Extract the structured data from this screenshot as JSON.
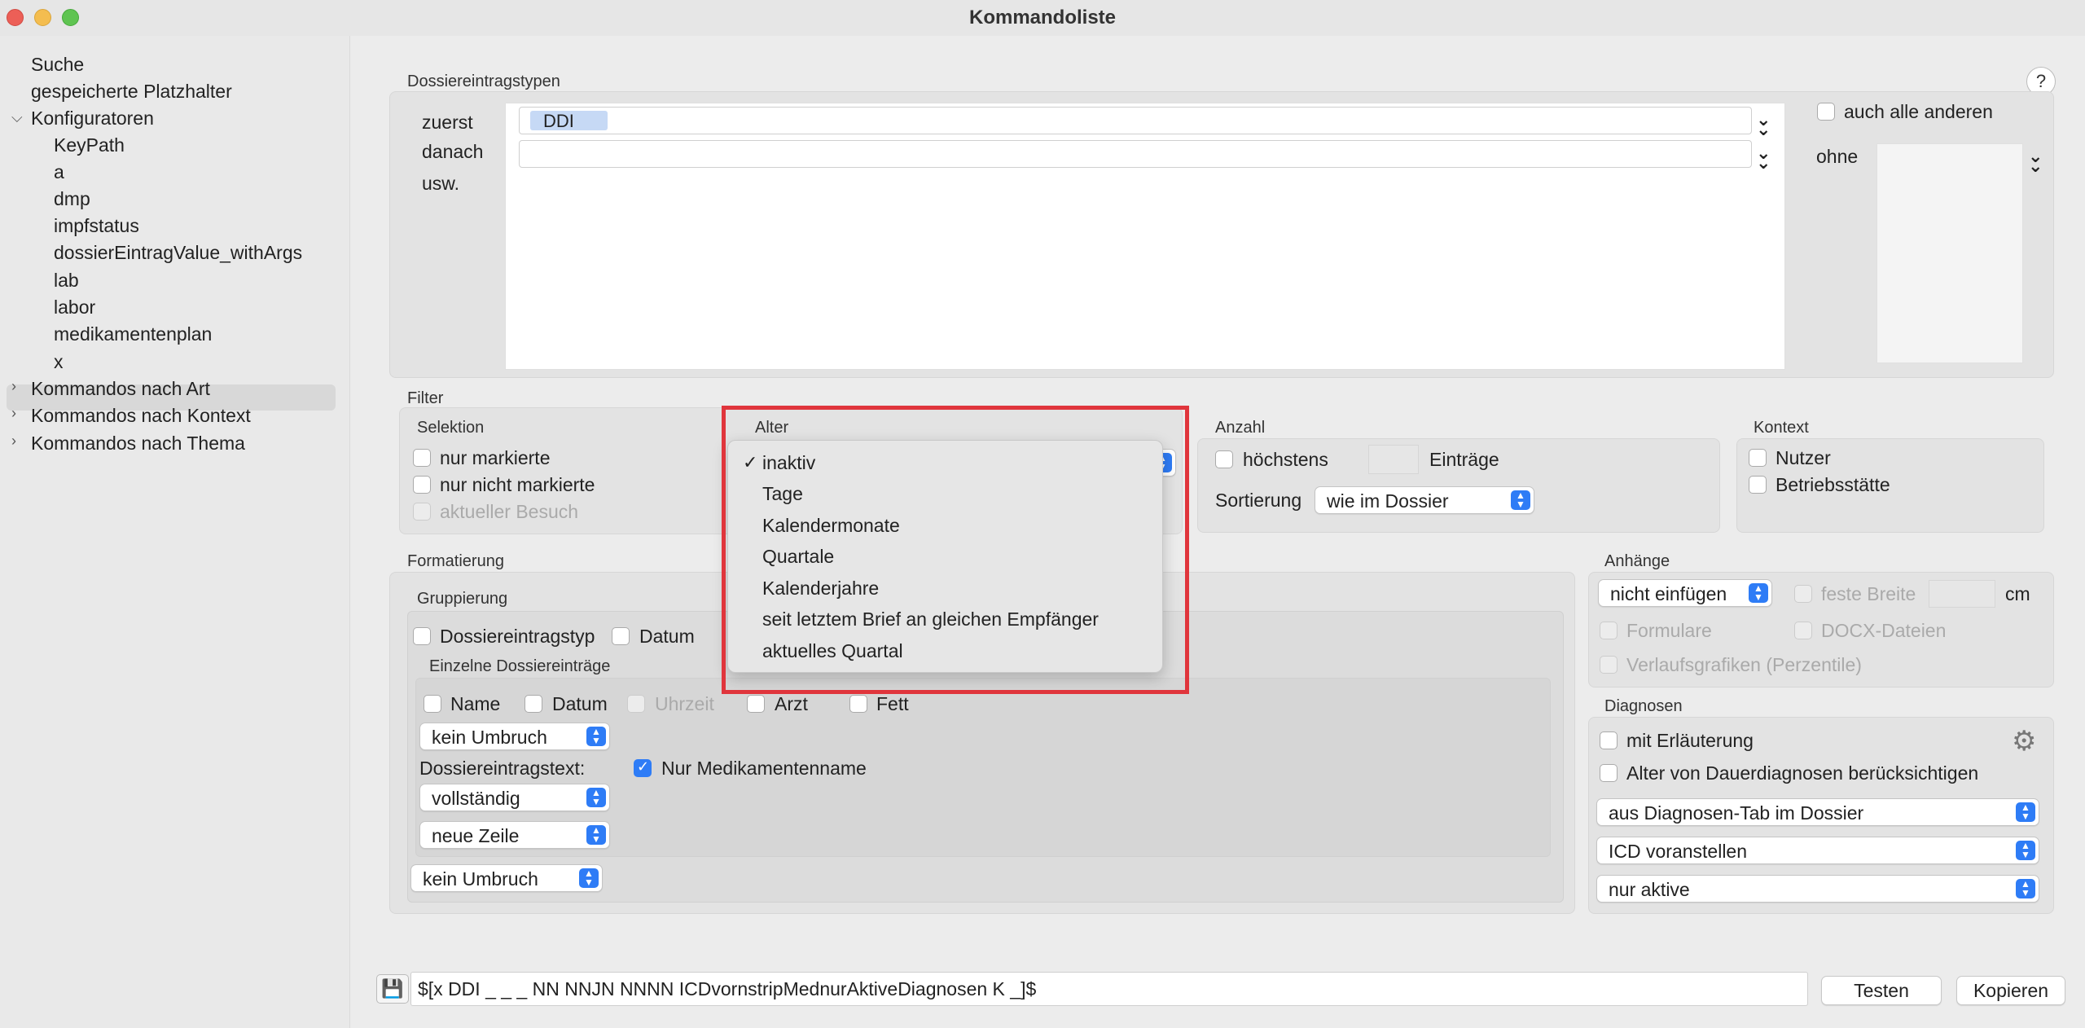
{
  "window": {
    "title": "Kommandoliste"
  },
  "sidebar": {
    "items": [
      {
        "label": "Suche"
      },
      {
        "label": "gespeicherte Platzhalter"
      },
      {
        "label": "Konfiguratoren"
      },
      {
        "label": "KeyPath"
      },
      {
        "label": "a"
      },
      {
        "label": "dmp"
      },
      {
        "label": "impfstatus"
      },
      {
        "label": "dossierEintragValue_withArgs"
      },
      {
        "label": "lab"
      },
      {
        "label": "labor"
      },
      {
        "label": "medikamentenplan"
      },
      {
        "label": "x"
      },
      {
        "label": "Kommandos nach Art"
      },
      {
        "label": "Kommandos nach Kontext"
      },
      {
        "label": "Kommandos nach Thema"
      }
    ]
  },
  "types": {
    "section": "Dossiereintragstypen",
    "first_label": "zuerst",
    "then_label": "danach",
    "etc_label": "usw.",
    "first_token": "DDI",
    "all_others": "auch alle anderen",
    "without": "ohne",
    "help": "?"
  },
  "filter": {
    "section": "Filter",
    "selection": {
      "title": "Selektion",
      "only_marked": "nur markierte",
      "only_unmarked": "nur nicht markierte",
      "current_visit": "aktueller Besuch"
    },
    "age": {
      "title": "Alter",
      "options": [
        "inaktiv",
        "Tage",
        "Kalendermonate",
        "Quartale",
        "Kalenderjahre",
        "seit letztem Brief an gleichen Empfänger",
        "aktuelles Quartal"
      ],
      "selected": "inaktiv",
      "check": "✓"
    },
    "count": {
      "title": "Anzahl",
      "at_most": "höchstens",
      "entries": "Einträge",
      "sort_label": "Sortierung",
      "sort_value": "wie im Dossier"
    },
    "context": {
      "title": "Kontext",
      "user": "Nutzer",
      "site": "Betriebsstätte"
    }
  },
  "format": {
    "section": "Formatierung",
    "grouping": "Gruppierung",
    "by_type": "Dossiereintragstyp",
    "by_date": "Datum",
    "single": "Einzelne Dossiereinträge",
    "name": "Name",
    "date": "Datum",
    "time": "Uhrzeit",
    "doctor": "Arzt",
    "bold": "Fett",
    "wrap1": "kein Umbruch",
    "text_label": "Dossiereintragstext:",
    "med_only": "Nur Medikamentenname",
    "full": "vollständig",
    "newline": "neue Zeile",
    "wrap2": "kein Umbruch"
  },
  "attachments": {
    "section": "Anhänge",
    "insert": "nicht einfügen",
    "fixed_width": "feste Breite",
    "cm": "cm",
    "forms": "Formulare",
    "docx": "DOCX-Dateien",
    "charts": "Verlaufsgrafiken (Perzentile)"
  },
  "diagnoses": {
    "section": "Diagnosen",
    "with_expl": "mit Erläuterung",
    "age_perm": "Alter von Dauerdiagnosen berücksichtigen",
    "source": "aus Diagnosen-Tab im Dossier",
    "icd": "ICD voranstellen",
    "active": "nur aktive"
  },
  "footer": {
    "command": "$[x DDI _ _ _ NN NNJN NNNN ICDvornstripMednurAktiveDiagnosen K _]$",
    "test": "Testen",
    "copy": "Kopieren"
  },
  "colors": {
    "accent": "#2e7cf6",
    "highlight": "#e0353c"
  }
}
